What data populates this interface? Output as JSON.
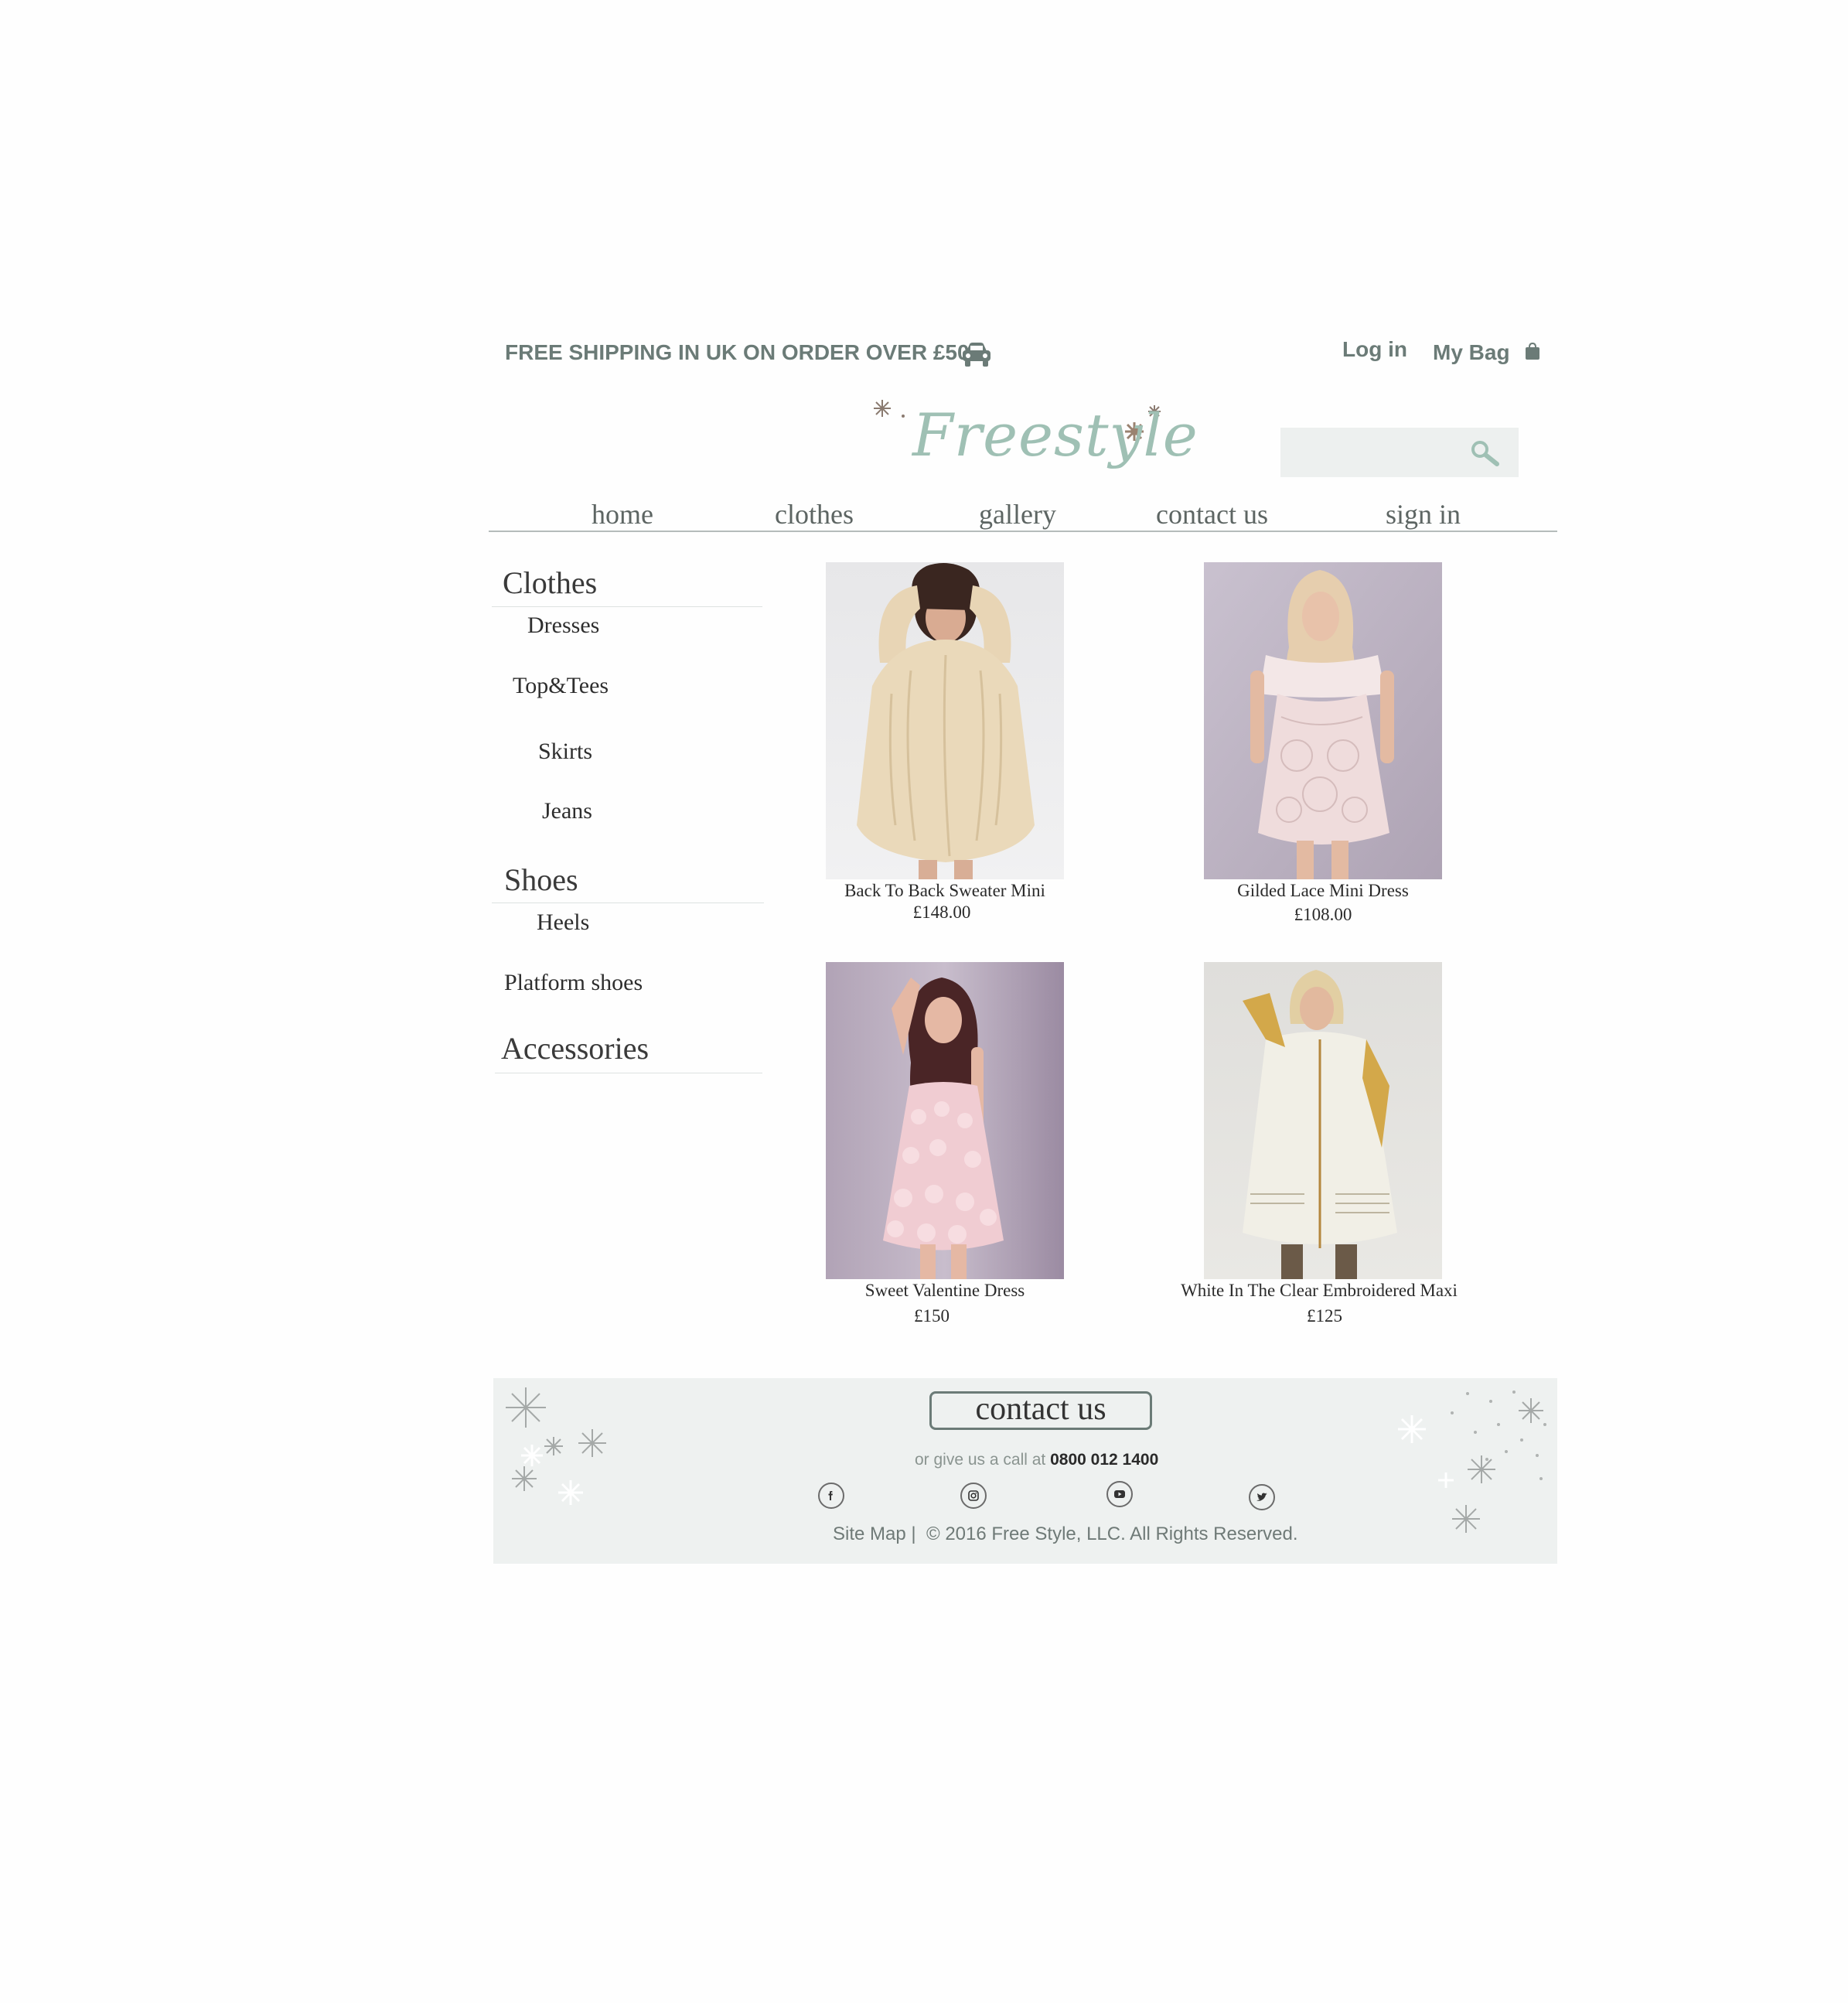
{
  "top_bar": {
    "shipping_text": "FREE SHIPPING IN UK ON ORDER OVER £50",
    "login_label": "Log in",
    "bag_label": "My Bag"
  },
  "logo": {
    "text": "Freestyle"
  },
  "search": {
    "placeholder": ""
  },
  "nav": {
    "items": [
      "home",
      "clothes",
      "gallery",
      "contact us",
      "sign in"
    ]
  },
  "sidebar": {
    "clothes": {
      "title": "Clothes",
      "items": [
        "Dresses",
        "Top&Tees",
        "Skirts",
        "Jeans"
      ]
    },
    "shoes": {
      "title": "Shoes",
      "items": [
        "Heels",
        "Platform shoes"
      ]
    },
    "accessories": {
      "title": "Accessories"
    }
  },
  "products": [
    {
      "name": "Back To Back Sweater Mini",
      "price": "£148.00"
    },
    {
      "name": "Gilded Lace Mini Dress",
      "price": "£108.00"
    },
    {
      "name": "Sweet Valentine Dress",
      "price": "£150"
    },
    {
      "name": "White In The Clear Embroidered Maxi",
      "price": "£125"
    }
  ],
  "footer": {
    "contact_label": "contact us",
    "call_prefix": "or give us a call at",
    "phone": "0800 012 1400",
    "sitemap_label": "Site Map",
    "separator": "|",
    "copyright": "© 2016 Free Style, LLC. All Rights Reserved."
  },
  "icons": {
    "car": "car-icon",
    "bag": "shopping-bag-icon",
    "search": "search-icon",
    "social": [
      "facebook-icon",
      "instagram-icon",
      "youtube-icon",
      "twitter-icon"
    ]
  },
  "colors": {
    "accent_text": "#6b7b77",
    "logo": "#9fc0b4",
    "footer_bg": "#eef1f0",
    "search_bg": "#edf0ef"
  }
}
